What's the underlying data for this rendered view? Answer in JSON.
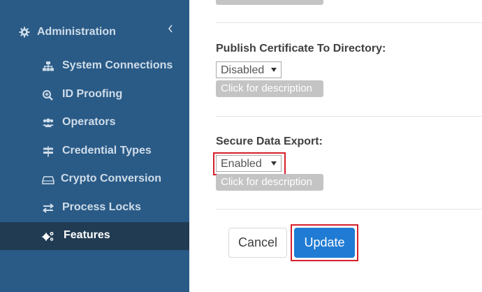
{
  "sidebar": {
    "section": {
      "label": "Administration",
      "icon": "gear-icon",
      "expand_icon": "chevron-left-icon"
    },
    "items": [
      {
        "label": "System Connections",
        "icon": "sitemap-icon"
      },
      {
        "label": "ID Proofing",
        "icon": "search-plus-icon"
      },
      {
        "label": "Operators",
        "icon": "users-icon"
      },
      {
        "label": "Credential Types",
        "icon": "signpost-icon"
      },
      {
        "label": "Crypto Conversion",
        "icon": "hdd-icon"
      },
      {
        "label": "Process Locks",
        "icon": "exchange-icon"
      },
      {
        "label": "Features",
        "icon": "cogs-icon",
        "active": true
      }
    ],
    "colors": {
      "background": "#2a5a86",
      "active_background": "#213b52",
      "text": "#cfdde9"
    }
  },
  "main": {
    "fields": [
      {
        "label": "Publish Certificate To Directory:",
        "value": "Disabled",
        "description_button": "Click for description"
      },
      {
        "label": "Secure Data Export:",
        "value": "Enabled",
        "description_button": "Click for description",
        "highlighted": true
      }
    ],
    "actions": {
      "cancel_label": "Cancel",
      "update_label": "Update",
      "update_color": "#1f7bd3",
      "update_highlighted": true
    },
    "highlight_color": "#d51f2a"
  }
}
